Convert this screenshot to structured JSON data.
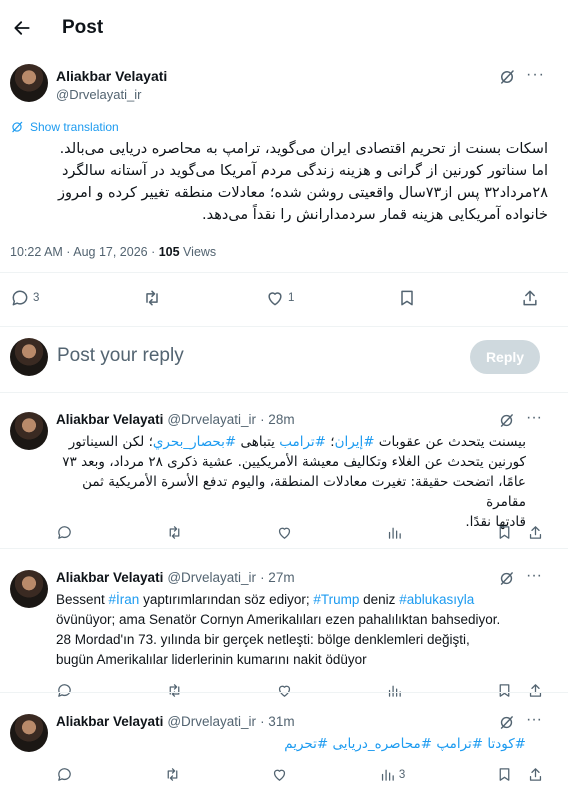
{
  "header": {
    "title": "Post"
  },
  "main_post": {
    "author_name": "Aliakbar Velayati",
    "author_handle": "@Drvelayati_ir",
    "show_translation": "Show translation",
    "text_lines": [
      "اسکات بسنت از تحریم اقتصادی ایران می‌گوید، ترامپ به محاصره دریایی می‌بالد.",
      "اما سناتور کورنین از گرانی و هزینه زندگی مردم آمریکا می‌گوید در آستانه سالگرد",
      "۲۸مرداد۳۲ پس از۷۳سال واقعیتی روشن شده؛ معادلات منطقه تغییر کرده و امروز",
      "خانواده آمریکایی هزینه قمار سردمدارانش را نقداً می‌دهد."
    ],
    "timestamp": "10:22 AM · Aug 17, 2026 · ",
    "views_count": "105",
    "views_label": " Views",
    "reply_count": "3",
    "like_count": "1"
  },
  "composer": {
    "placeholder": "Post your reply",
    "button_label": "Reply"
  },
  "replies": [
    {
      "author_name": "Aliakbar Velayati",
      "author_handle": "@Drvelayati_ir",
      "time": "· 28m",
      "lang": "ar",
      "segments_lines": [
        [
          {
            "t": "بيسنت يتحدث عن عقوبات "
          },
          {
            "t": "#إيران",
            "tag": true
          },
          {
            "t": "؛ "
          },
          {
            "t": "#ترامب",
            "tag": true
          },
          {
            "t": " يتباهى "
          },
          {
            "t": "#بحصار_بحري",
            "tag": true
          },
          {
            "t": "؛ لكن السيناتور"
          }
        ],
        [
          {
            "t": "كورنين يتحدث عن الغلاء وتكاليف معيشة الأمريكيين. عشية ذكرى ٢٨ مرداد، وبعد ٧٣"
          }
        ],
        [
          {
            "t": "عامًا، اتضحت حقيقة: تغيرت معادلات المنطقة، واليوم تدفع الأسرة الأمريكية ثمن مقامرة"
          }
        ],
        [
          {
            "t": "قادتها نقدًا."
          }
        ]
      ],
      "views": ""
    },
    {
      "author_name": "Aliakbar Velayati",
      "author_handle": "@Drvelayati_ir",
      "time": "· 27m",
      "lang": "tr",
      "segments_lines": [
        [
          {
            "t": "Bessent "
          },
          {
            "t": "#İran",
            "tag": true
          },
          {
            "t": " yaptırımlarından söz ediyor; "
          },
          {
            "t": "#Trump",
            "tag": true
          },
          {
            "t": " deniz "
          },
          {
            "t": "#ablukasıyla",
            "tag": true
          }
        ],
        [
          {
            "t": "övünüyor; ama Senatör Cornyn Amerikalıları ezen pahalılıktan bahsediyor."
          }
        ],
        [
          {
            "t": "28 Mordad'ın 73. yılında bir gerçek netleşti: bölge denklemleri değişti,"
          }
        ],
        [
          {
            "t": "bugün Amerikalılar liderlerinin kumarını nakit ödüyor"
          }
        ]
      ],
      "views": ""
    },
    {
      "author_name": "Aliakbar Velayati",
      "author_handle": "@Drvelayati_ir",
      "time": "· 31m",
      "lang": "fa",
      "segments_lines": [
        [
          {
            "t": "#کودتا",
            "tag": true
          },
          {
            "t": " "
          },
          {
            "t": "#ترامپ",
            "tag": true
          },
          {
            "t": " "
          },
          {
            "t": "#محاصره_دریایی",
            "tag": true
          },
          {
            "t": " "
          },
          {
            "t": "#تحریم",
            "tag": true
          }
        ]
      ],
      "views": "3"
    }
  ],
  "colors": {
    "accent": "#1d9bf0",
    "muted": "#536471",
    "text": "#0f1419",
    "divider": "#eff3f4",
    "reply_button_disabled": "#cfd9de"
  },
  "icons": [
    "back-arrow-icon",
    "grok-icon",
    "more-icon",
    "translate-icon",
    "reply-icon",
    "retweet-icon",
    "like-icon",
    "bookmark-icon",
    "share-icon",
    "views-icon"
  ]
}
